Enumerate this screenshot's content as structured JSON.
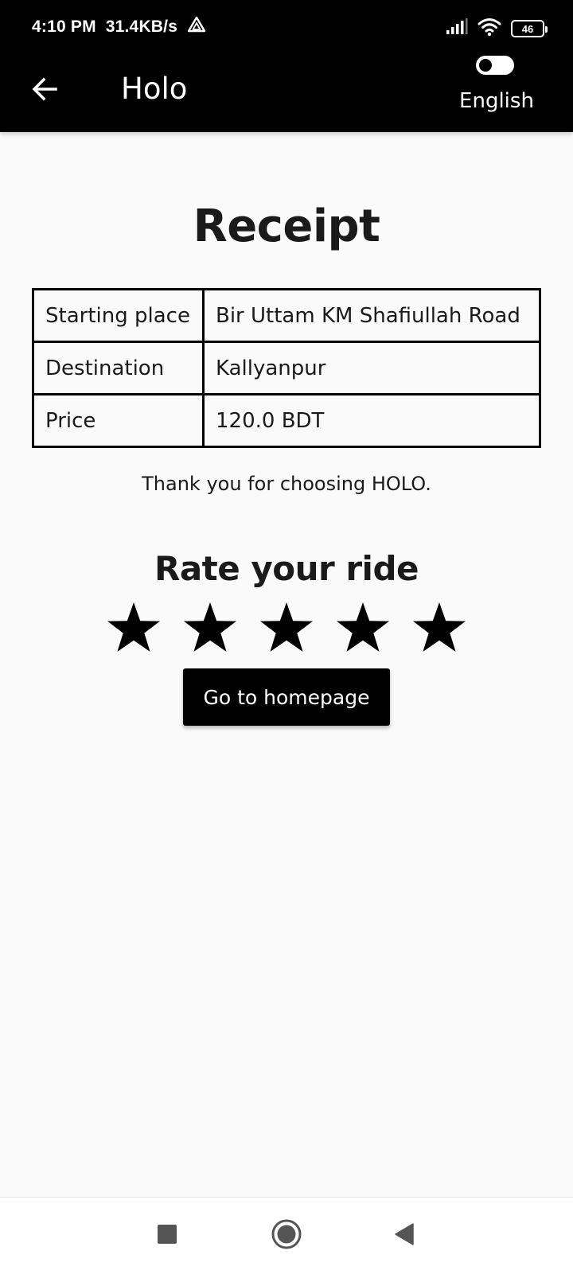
{
  "status_bar": {
    "time": "4:10 PM",
    "network_speed": "31.4KB/s",
    "battery_level": "46",
    "icons": [
      "drive-icon",
      "signal-icon",
      "wifi-icon",
      "battery-icon"
    ]
  },
  "app_bar": {
    "title": "Holo",
    "back_icon": "arrow-left-icon",
    "language_label": "English",
    "language_toggle_on": false
  },
  "receipt": {
    "title": "Receipt",
    "rows": [
      {
        "label": "Starting place",
        "value": "Bir Uttam KM Shafiullah Road"
      },
      {
        "label": "Destination",
        "value": "Kallyanpur"
      },
      {
        "label": "Price",
        "value": "120.0 BDT"
      }
    ],
    "thank_you": "Thank you for choosing HOLO."
  },
  "rating": {
    "title": "Rate your ride",
    "max_stars": 5,
    "star_icon": "star-icon"
  },
  "actions": {
    "home_button_label": "Go to homepage"
  },
  "nav_bar": {
    "icons": [
      "recents-square-icon",
      "home-circle-icon",
      "back-triangle-icon"
    ]
  },
  "colors": {
    "bar_background": "#000000",
    "page_background": "#fafafa",
    "text": "#1a1a1a",
    "button_background": "#000000",
    "button_text": "#ffffff"
  }
}
